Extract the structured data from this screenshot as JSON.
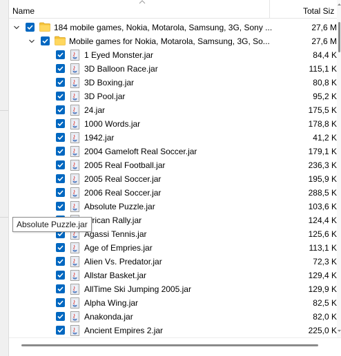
{
  "columns": {
    "name": "Name",
    "size": "Total Siz"
  },
  "tree": [
    {
      "level": 0,
      "type": "folder",
      "name": "184 mobile games, Nokia, Motarola, Samsung, 3G, Sony ...",
      "size": "27,6 M",
      "expanded": true,
      "checked": true
    },
    {
      "level": 1,
      "type": "folder",
      "name": "Mobile games for  Nokia, Motarola, Samsung, 3G, So...",
      "size": "27,6 M",
      "expanded": true,
      "checked": true
    },
    {
      "level": 2,
      "type": "file",
      "name": "1 Eyed Monster.jar",
      "size": "84,4 K",
      "checked": true
    },
    {
      "level": 2,
      "type": "file",
      "name": "3D Balloon Race.jar",
      "size": "115,1 K",
      "checked": true
    },
    {
      "level": 2,
      "type": "file",
      "name": "3D Boxing.jar",
      "size": "80,8 K",
      "checked": true
    },
    {
      "level": 2,
      "type": "file",
      "name": "3D Pool.jar",
      "size": "95,2 K",
      "checked": true
    },
    {
      "level": 2,
      "type": "file",
      "name": "24.jar",
      "size": "175,5 K",
      "checked": true
    },
    {
      "level": 2,
      "type": "file",
      "name": "1000 Words.jar",
      "size": "178,8 K",
      "checked": true
    },
    {
      "level": 2,
      "type": "file",
      "name": "1942.jar",
      "size": "41,2 K",
      "checked": true
    },
    {
      "level": 2,
      "type": "file",
      "name": "2004 Gameloft Real Soccer.jar",
      "size": "179,1 K",
      "checked": true
    },
    {
      "level": 2,
      "type": "file",
      "name": "2005 Real Football.jar",
      "size": "236,3 K",
      "checked": true
    },
    {
      "level": 2,
      "type": "file",
      "name": "2005 Real Soccer.jar",
      "size": "195,9 K",
      "checked": true
    },
    {
      "level": 2,
      "type": "file",
      "name": "2006 Real Soccer.jar",
      "size": "288,5 K",
      "checked": true
    },
    {
      "level": 2,
      "type": "file",
      "name": "Absolute Puzzle.jar",
      "size": "103,6 K",
      "checked": true
    },
    {
      "level": 2,
      "type": "file",
      "name": "African Rally.jar",
      "size": "124,4 K",
      "checked": true
    },
    {
      "level": 2,
      "type": "file",
      "name": "Agassi Tennis.jar",
      "size": "125,6 K",
      "checked": true
    },
    {
      "level": 2,
      "type": "file",
      "name": "Age of Empries.jar",
      "size": "113,1 K",
      "checked": true
    },
    {
      "level": 2,
      "type": "file",
      "name": "Alien Vs. Predator.jar",
      "size": "72,3 K",
      "checked": true
    },
    {
      "level": 2,
      "type": "file",
      "name": "Allstar Basket.jar",
      "size": "129,4 K",
      "checked": true
    },
    {
      "level": 2,
      "type": "file",
      "name": "AllTime Ski Jumping 2005.jar",
      "size": "129,9 K",
      "checked": true
    },
    {
      "level": 2,
      "type": "file",
      "name": "Alpha Wing.jar",
      "size": "82,5 K",
      "checked": true
    },
    {
      "level": 2,
      "type": "file",
      "name": "Anakonda.jar",
      "size": "82,0 K",
      "checked": true
    },
    {
      "level": 2,
      "type": "file",
      "name": "Ancient Empires 2.jar",
      "size": "225,0 K",
      "checked": true
    },
    {
      "level": 2,
      "type": "file",
      "name": "",
      "size": "",
      "checked": true
    }
  ],
  "tooltip": {
    "text": "Absolute Puzzle.jar"
  },
  "colors": {
    "accent": "#0067c0",
    "folder": "#f5c33b",
    "scroll_thumb": "#8a8a8a"
  },
  "icons": {
    "folder": "folder-icon",
    "file": "jar-file-icon",
    "checkbox": "checkbox-checked-icon"
  }
}
